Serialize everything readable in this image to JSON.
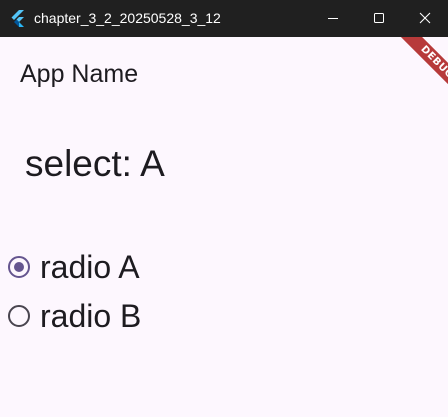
{
  "window": {
    "title": "chapter_3_2_20250528_3_12",
    "icon": "flutter-logo-icon",
    "controls": [
      "minimize-icon",
      "maximize-icon",
      "close-icon"
    ]
  },
  "app": {
    "title": "App Name",
    "selected_text": "select: A",
    "radios": [
      {
        "label": "radio A",
        "selected": true
      },
      {
        "label": "radio B",
        "selected": false
      }
    ],
    "debug_banner": "DEBUG"
  },
  "colors": {
    "titlebar": "#202020",
    "background": "#fdf7fe",
    "accent": "#65558f",
    "radio_unselected": "#49454f",
    "debug_banner": "#b73a3a"
  }
}
